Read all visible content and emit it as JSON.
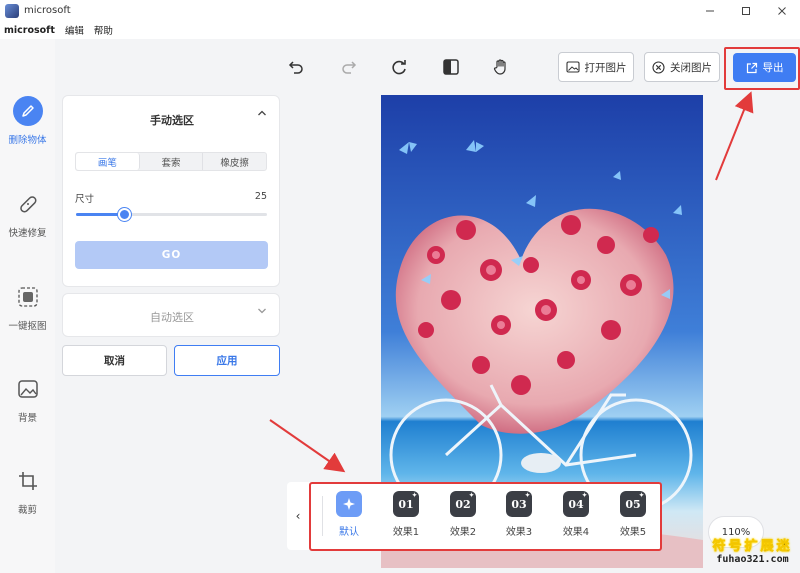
{
  "window": {
    "title": "microsoft",
    "controls": [
      "minimize-icon",
      "maximize-icon",
      "close-icon"
    ]
  },
  "menubar": {
    "app": "microsoft",
    "items": [
      "编辑",
      "帮助"
    ]
  },
  "rail": {
    "items": [
      {
        "label": "删除物体",
        "icon": "pen-icon",
        "active": true
      },
      {
        "label": "快速修复",
        "icon": "bandage-icon",
        "active": false
      },
      {
        "label": "一键抠图",
        "icon": "cutout-icon",
        "active": false
      },
      {
        "label": "背景",
        "icon": "image-icon",
        "active": false
      },
      {
        "label": "裁剪",
        "icon": "crop-icon",
        "active": false
      }
    ]
  },
  "toolbar": {
    "icons": [
      "undo-icon",
      "redo-icon",
      "rotate-icon",
      "flip-icon",
      "hand-icon"
    ],
    "open_label": "打开图片",
    "close_label": "关闭图片",
    "export_label": "导出"
  },
  "manual_panel": {
    "title": "手动选区",
    "modes": [
      "画笔",
      "套索",
      "橡皮擦"
    ],
    "active_mode": "画笔",
    "size_label": "尺寸",
    "size_value": "25",
    "size_fraction": 0.25,
    "go_label": "GO"
  },
  "auto_panel": {
    "title": "自动选区"
  },
  "actions": {
    "cancel_label": "取消",
    "apply_label": "应用"
  },
  "effects": {
    "items": [
      {
        "label": "默认",
        "badge": "",
        "active": true
      },
      {
        "label": "效果1",
        "badge": "01",
        "active": false
      },
      {
        "label": "效果2",
        "badge": "02",
        "active": false
      },
      {
        "label": "效果3",
        "badge": "03",
        "active": false
      },
      {
        "label": "效果4",
        "badge": "04",
        "active": false
      },
      {
        "label": "效果5",
        "badge": "05",
        "active": false
      }
    ]
  },
  "zoom": "110%",
  "watermark": {
    "top": "符号扩展迷",
    "bottom": "fuhao321.com"
  },
  "colors": {
    "accent": "#3f7df3",
    "annotation": "#e23b3b"
  }
}
